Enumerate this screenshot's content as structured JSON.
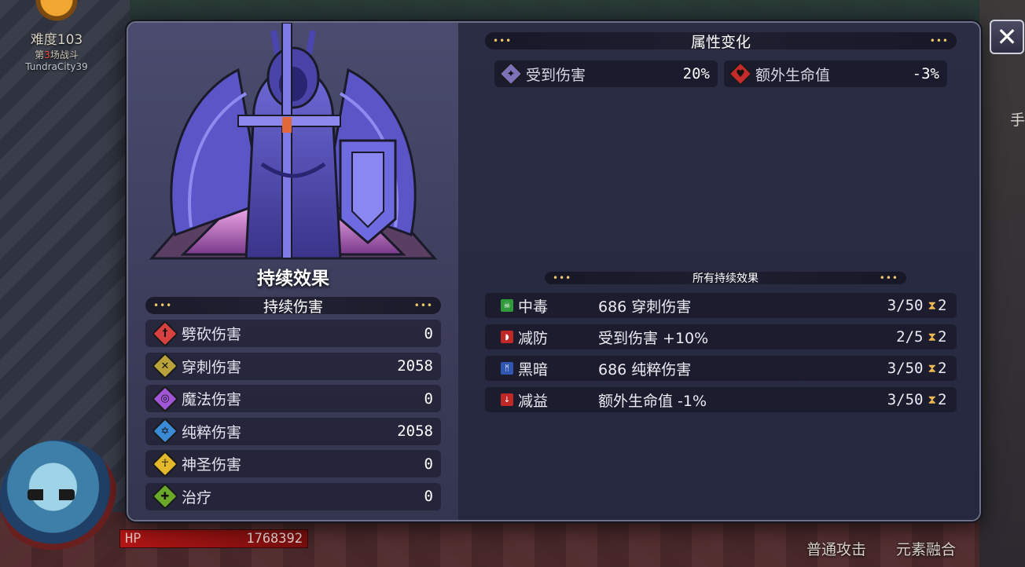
{
  "hud": {
    "difficulty": "难度103",
    "battle_prefix": "第",
    "battle_num": "3",
    "battle_suffix": "场战斗",
    "city": "TundraCity39",
    "hp_label": "HP",
    "hp_value": "1768392",
    "attack_btn": "普通攻击",
    "fusion_btn": "元素融合",
    "right_partial": "手"
  },
  "modal": {
    "close_label": "✕",
    "left": {
      "title": "持续效果",
      "section_title": "持续伤害",
      "damage_rows": [
        {
          "name": "劈砍伤害",
          "value": "0",
          "icon": "slash-damage-icon",
          "color": "#d94141",
          "glyph": "†"
        },
        {
          "name": "穿刺伤害",
          "value": "2058",
          "icon": "pierce-damage-icon",
          "color": "#b9a23a",
          "glyph": "✕"
        },
        {
          "name": "魔法伤害",
          "value": "0",
          "icon": "magic-damage-icon",
          "color": "#a056d6",
          "glyph": "◎"
        },
        {
          "name": "纯粹伤害",
          "value": "2058",
          "icon": "pure-damage-icon",
          "color": "#3a8ad6",
          "glyph": "✡"
        },
        {
          "name": "神圣伤害",
          "value": "0",
          "icon": "holy-damage-icon",
          "color": "#e3b82a",
          "glyph": "☥"
        },
        {
          "name": "治疗",
          "value": "0",
          "icon": "heal-icon",
          "color": "#6aa82a",
          "glyph": "✚"
        }
      ]
    },
    "right": {
      "attr_title": "属性变化",
      "attributes": [
        {
          "name": "受到伤害",
          "value": "20%",
          "icon": "damage-taken-icon",
          "color": "#7d72b8"
        },
        {
          "name": "额外生命值",
          "value": "-3%",
          "icon": "extra-hp-icon",
          "color": "#c52b2b"
        }
      ],
      "effects_title": "所有持续效果",
      "effects": [
        {
          "name": "中毒",
          "desc": "686 穿刺伤害",
          "stack": "3/50",
          "turns": "2",
          "icon": "poison-icon",
          "color": "#2f9a3a",
          "glyph": "☠"
        },
        {
          "name": "减防",
          "desc": "受到伤害 +10%",
          "stack": "2/5",
          "turns": "2",
          "icon": "armor-down-icon",
          "color": "#c02828",
          "glyph": "◗"
        },
        {
          "name": "黑暗",
          "desc": "686 纯粹伤害",
          "stack": "3/50",
          "turns": "2",
          "icon": "darkness-icon",
          "color": "#2f56b0",
          "glyph": "ᛗ"
        },
        {
          "name": "减益",
          "desc": "额外生命值 -1%",
          "stack": "3/50",
          "turns": "2",
          "icon": "debuff-icon",
          "color": "#c02828",
          "glyph": "↓"
        }
      ]
    }
  }
}
